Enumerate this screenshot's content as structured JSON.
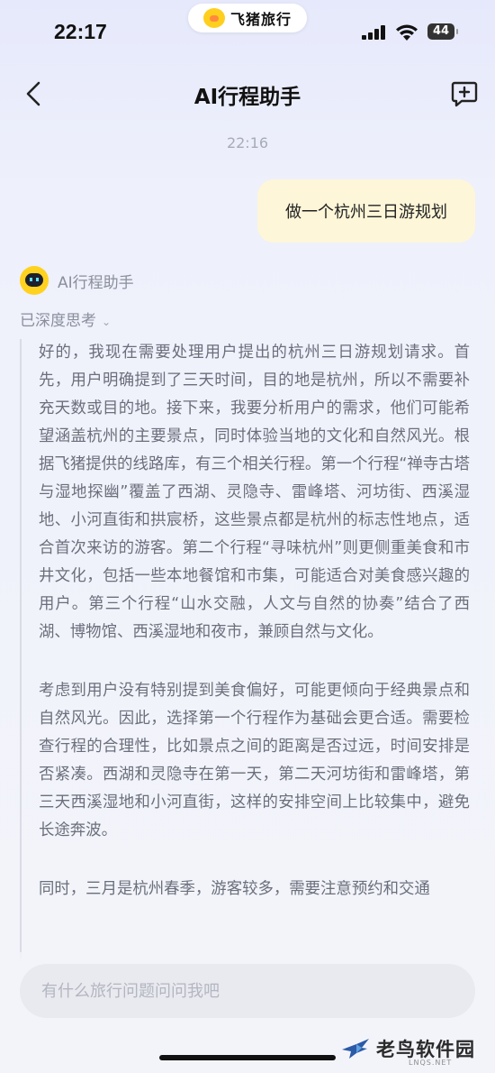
{
  "status_bar": {
    "time": "22:17",
    "app_pill_label": "飞猪旅行",
    "battery": "44"
  },
  "header": {
    "title": "AI行程助手"
  },
  "chat": {
    "timestamp": "22:16",
    "user_message": "做一个杭州三日游规划",
    "assistant_name": "AI行程助手",
    "deep_thinking_label": "已深度思考",
    "thinking_paragraphs": [
      "好的，我现在需要处理用户提出的杭州三日游规划请求。首先，用户明确提到了三天时间，目的地是杭州，所以不需要补充天数或目的地。接下来，我要分析用户的需求，他们可能希望涵盖杭州的主要景点，同时体验当地的文化和自然风光。根据飞猪提供的线路库，有三个相关行程。第一个行程“禅寺古塔与湿地探幽”覆盖了西湖、灵隐寺、雷峰塔、河坊街、西溪湿地、小河直街和拱宸桥，这些景点都是杭州的标志性地点，适合首次来访的游客。第二个行程“寻味杭州”则更侧重美食和市井文化，包括一些本地餐馆和市集，可能适合对美食感兴趣的用户。第三个行程“山水交融，人文与自然的协奏”结合了西湖、博物馆、西溪湿地和夜市，兼顾自然与文化。",
      "考虑到用户没有特别提到美食偏好，可能更倾向于经典景点和自然风光。因此，选择第一个行程作为基础会更合适。需要检查行程的合理性，比如景点之间的距离是否过远，时间安排是否紧凑。西湖和灵隐寺在第一天，第二天河坊街和雷峰塔，第三天西溪湿地和小河直街，这样的安排空间上比较集中，避免长途奔波。",
      "同时，三月是杭州春季，游客较多，需要注意预约和交通"
    ]
  },
  "input": {
    "placeholder": "有什么旅行问题问问我吧"
  },
  "watermark": {
    "text": "老鸟软件园",
    "subtext": "LNQS.NET"
  },
  "colors": {
    "user_bubble": "#fdf6d8",
    "background": "#eef0fb",
    "brand_yellow": "#ffd21f"
  }
}
